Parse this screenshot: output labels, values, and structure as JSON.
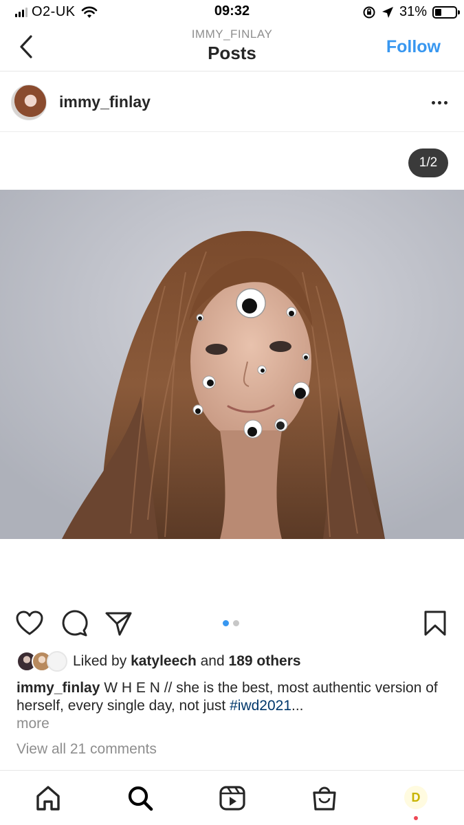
{
  "status_bar": {
    "carrier": "O2-UK",
    "time": "09:32",
    "battery": "31%",
    "battery_level": 0.31
  },
  "nav": {
    "subtitle": "IMMY_FINLAY",
    "title": "Posts",
    "follow_label": "Follow"
  },
  "post": {
    "username": "immy_finlay",
    "counter": "1/2",
    "carousel_index": 1,
    "carousel_total": 2
  },
  "likes": {
    "prefix": "Liked by ",
    "user": "katyleech",
    "middle": " and ",
    "others": "189 others"
  },
  "caption": {
    "username": "immy_finlay",
    "text": " W H E N // she is the best, most authentic version of herself, every single day, not just ",
    "hashtag": "#iwd2021",
    "ellipsis": "...",
    "more": "more"
  },
  "comments_link": "View all 21 comments",
  "tabbar": {
    "profile_initial": "D"
  },
  "colors": {
    "accent": "#3897f0",
    "hashtag": "#00376b",
    "muted": "#8e8e8e",
    "notification": "#ed4956"
  },
  "icons": [
    "back-chevron-icon",
    "more-icon",
    "heart-icon",
    "comment-icon",
    "share-icon",
    "bookmark-icon",
    "home-icon",
    "search-icon",
    "reels-icon",
    "shop-icon",
    "wifi-icon",
    "location-icon",
    "rotation-lock-icon"
  ]
}
